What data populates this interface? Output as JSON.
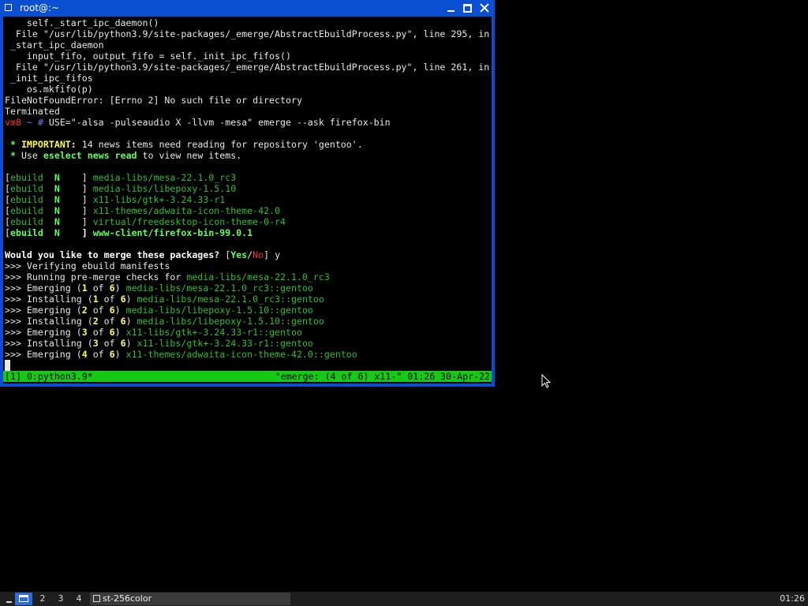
{
  "window": {
    "title": "root@:~"
  },
  "terminal": {
    "lines": [
      [
        {
          "t": "    self._start_ipc_daemon()",
          "c": "bl"
        }
      ],
      [
        {
          "t": "  File \"/usr/lib/python3.9/site-packages/_emerge/AbstractEbuildProcess.py\", line 295, in",
          "c": "bl"
        }
      ],
      [
        {
          "t": " _start_ipc_daemon",
          "c": "bl"
        }
      ],
      [
        {
          "t": "    input_fifo, output_fifo = self._init_ipc_fifos()",
          "c": "bl"
        }
      ],
      [
        {
          "t": "  File \"/usr/lib/python3.9/site-packages/_emerge/AbstractEbuildProcess.py\", line 261, in",
          "c": "bl"
        }
      ],
      [
        {
          "t": " _init_ipc_fifos",
          "c": "bl"
        }
      ],
      [
        {
          "t": "    os.mkfifo(p)",
          "c": "bl"
        }
      ],
      [
        {
          "t": "FileNotFoundError: [Errno 2] No such file or directory",
          "c": "bl"
        }
      ],
      [
        {
          "t": "Terminated",
          "c": "bl"
        }
      ],
      [
        {
          "t": "vm8",
          "c": "r"
        },
        {
          "t": " ~ # ",
          "c": "b"
        },
        {
          "t": "USE=\"-alsa -pulseaudio X -llvm -mesa\" emerge --ask firefox-bin",
          "c": "bl"
        }
      ],
      [],
      [
        {
          "t": " * ",
          "c": "lg"
        },
        {
          "t": "IMPORTANT:",
          "c": "y"
        },
        {
          "t": " 14 news items need reading for repository 'gentoo'.",
          "c": "bl"
        }
      ],
      [
        {
          "t": " * ",
          "c": "lg"
        },
        {
          "t": "Use ",
          "c": "bl"
        },
        {
          "t": "eselect news read",
          "c": "lg"
        },
        {
          "t": " to view new items.",
          "c": "bl"
        }
      ],
      [],
      [
        {
          "t": "[",
          "c": "bl"
        },
        {
          "t": "ebuild  ",
          "c": "g"
        },
        {
          "t": "N",
          "c": "lg"
        },
        {
          "t": "    ] ",
          "c": "bl"
        },
        {
          "t": "media-libs/mesa-22.1.0_rc3",
          "c": "g"
        }
      ],
      [
        {
          "t": "[",
          "c": "bl"
        },
        {
          "t": "ebuild  ",
          "c": "g"
        },
        {
          "t": "N",
          "c": "lg"
        },
        {
          "t": "    ] ",
          "c": "bl"
        },
        {
          "t": "media-libs/libepoxy-1.5.10",
          "c": "g"
        }
      ],
      [
        {
          "t": "[",
          "c": "bl"
        },
        {
          "t": "ebuild  ",
          "c": "g"
        },
        {
          "t": "N",
          "c": "lg"
        },
        {
          "t": "    ] ",
          "c": "bl"
        },
        {
          "t": "x11-libs/gtk+-3.24.33-r1",
          "c": "g"
        }
      ],
      [
        {
          "t": "[",
          "c": "bl"
        },
        {
          "t": "ebuild  ",
          "c": "g"
        },
        {
          "t": "N",
          "c": "lg"
        },
        {
          "t": "    ] ",
          "c": "bl"
        },
        {
          "t": "x11-themes/adwaita-icon-theme-42.0",
          "c": "g"
        }
      ],
      [
        {
          "t": "[",
          "c": "bl"
        },
        {
          "t": "ebuild  ",
          "c": "g"
        },
        {
          "t": "N",
          "c": "lg"
        },
        {
          "t": "    ] ",
          "c": "bl"
        },
        {
          "t": "virtual/freedesktop-icon-theme-0-r4",
          "c": "g"
        }
      ],
      [
        {
          "t": "[",
          "c": "bl"
        },
        {
          "t": "ebuild  ",
          "c": "lg"
        },
        {
          "t": "N",
          "c": "lg"
        },
        {
          "t": "    ] ",
          "c": "w"
        },
        {
          "t": "www-client/firefox-bin-99.0.1",
          "c": "lg"
        }
      ],
      [],
      [
        {
          "t": "Would you like to merge these packages?",
          "c": "w"
        },
        {
          "t": " [",
          "c": "bl"
        },
        {
          "t": "Yes",
          "c": "lg"
        },
        {
          "t": "/",
          "c": "bl"
        },
        {
          "t": "No",
          "c": "r"
        },
        {
          "t": "] y",
          "c": "bl"
        }
      ],
      [
        {
          "t": ">>> Verifying ebuild manifests",
          "c": "bl"
        }
      ],
      [
        {
          "t": ">>> Running pre-merge checks for ",
          "c": "bl"
        },
        {
          "t": "media-libs/mesa-22.1.0_rc3",
          "c": "g"
        }
      ],
      [
        {
          "t": ">>> Emerging (",
          "c": "bl"
        },
        {
          "t": "1",
          "c": "y"
        },
        {
          "t": " of ",
          "c": "bl"
        },
        {
          "t": "6",
          "c": "y"
        },
        {
          "t": ") ",
          "c": "bl"
        },
        {
          "t": "media-libs/mesa-22.1.0_rc3::gentoo",
          "c": "g"
        }
      ],
      [
        {
          "t": ">>> Installing (",
          "c": "bl"
        },
        {
          "t": "1",
          "c": "y"
        },
        {
          "t": " of ",
          "c": "bl"
        },
        {
          "t": "6",
          "c": "y"
        },
        {
          "t": ") ",
          "c": "bl"
        },
        {
          "t": "media-libs/mesa-22.1.0_rc3::gentoo",
          "c": "g"
        }
      ],
      [
        {
          "t": ">>> Emerging (",
          "c": "bl"
        },
        {
          "t": "2",
          "c": "y"
        },
        {
          "t": " of ",
          "c": "bl"
        },
        {
          "t": "6",
          "c": "y"
        },
        {
          "t": ") ",
          "c": "bl"
        },
        {
          "t": "media-libs/libepoxy-1.5.10::gentoo",
          "c": "g"
        }
      ],
      [
        {
          "t": ">>> Installing (",
          "c": "bl"
        },
        {
          "t": "2",
          "c": "y"
        },
        {
          "t": " of ",
          "c": "bl"
        },
        {
          "t": "6",
          "c": "y"
        },
        {
          "t": ") ",
          "c": "bl"
        },
        {
          "t": "media-libs/libepoxy-1.5.10::gentoo",
          "c": "g"
        }
      ],
      [
        {
          "t": ">>> Emerging (",
          "c": "bl"
        },
        {
          "t": "3",
          "c": "y"
        },
        {
          "t": " of ",
          "c": "bl"
        },
        {
          "t": "6",
          "c": "y"
        },
        {
          "t": ") ",
          "c": "bl"
        },
        {
          "t": "x11-libs/gtk+-3.24.33-r1::gentoo",
          "c": "g"
        }
      ],
      [
        {
          "t": ">>> Installing (",
          "c": "bl"
        },
        {
          "t": "3",
          "c": "y"
        },
        {
          "t": " of ",
          "c": "bl"
        },
        {
          "t": "6",
          "c": "y"
        },
        {
          "t": ") ",
          "c": "bl"
        },
        {
          "t": "x11-libs/gtk+-3.24.33-r1::gentoo",
          "c": "g"
        }
      ],
      [
        {
          "t": ">>> Emerging (",
          "c": "bl"
        },
        {
          "t": "4",
          "c": "y"
        },
        {
          "t": " of ",
          "c": "bl"
        },
        {
          "t": "6",
          "c": "y"
        },
        {
          "t": ") ",
          "c": "bl"
        },
        {
          "t": "x11-themes/adwaita-icon-theme-42.0::gentoo",
          "c": "g"
        }
      ]
    ],
    "status_left": "[1] 0:python3.9*",
    "status_right": "\"emerge: (4 of 6) x11-\" 01:26 30-Apr-22"
  },
  "taskbar": {
    "workspaces": [
      "",
      "2",
      "3",
      "4"
    ],
    "active_workspace": 0,
    "task_label": "st-256color",
    "clock": "01:26"
  },
  "colors": {
    "titlebar": "#0a4fd1",
    "statusbar": "#15c915",
    "green": "#2fbf2f",
    "bright_green": "#5fff5f",
    "yellow": "#ffff55",
    "red": "#ff3030",
    "blue": "#6b7cff"
  }
}
